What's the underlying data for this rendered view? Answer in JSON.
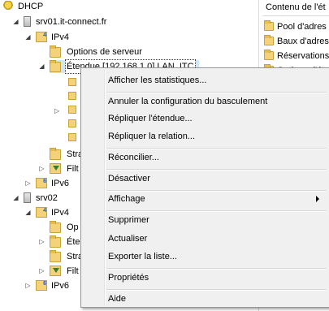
{
  "tree": {
    "root": "DHCP",
    "server1": "srv01.it-connect.fr",
    "s1_ipv4": "IPv4",
    "s1_options": "Options de serveur",
    "s1_scope": "Étendue [192.168.1.0] LAN_ITC",
    "s1_strat": "Stra",
    "s1_filt": "Filt",
    "s1_ipv6": "IPv6",
    "server2": "srv02",
    "s2_ipv4": "IPv4",
    "s2_options": "Op",
    "s2_scope": "Éte",
    "s2_strat": "Stra",
    "s2_filt": "Filt",
    "s2_ipv6": "IPv6"
  },
  "right_pane": {
    "header": "Contenu de l'ét",
    "items": [
      "Pool d'adres",
      "Baux d'adres",
      "Réservations",
      "Options d'ét"
    ]
  },
  "context_menu": {
    "items": [
      "Afficher les statistiques...",
      "Annuler la configuration du basculement",
      "Répliquer l'étendue...",
      "Répliquer la relation...",
      "Réconcilier...",
      "Désactiver",
      "Affichage",
      "Supprimer",
      "Actualiser",
      "Exporter la liste...",
      "Propriétés",
      "Aide"
    ]
  }
}
